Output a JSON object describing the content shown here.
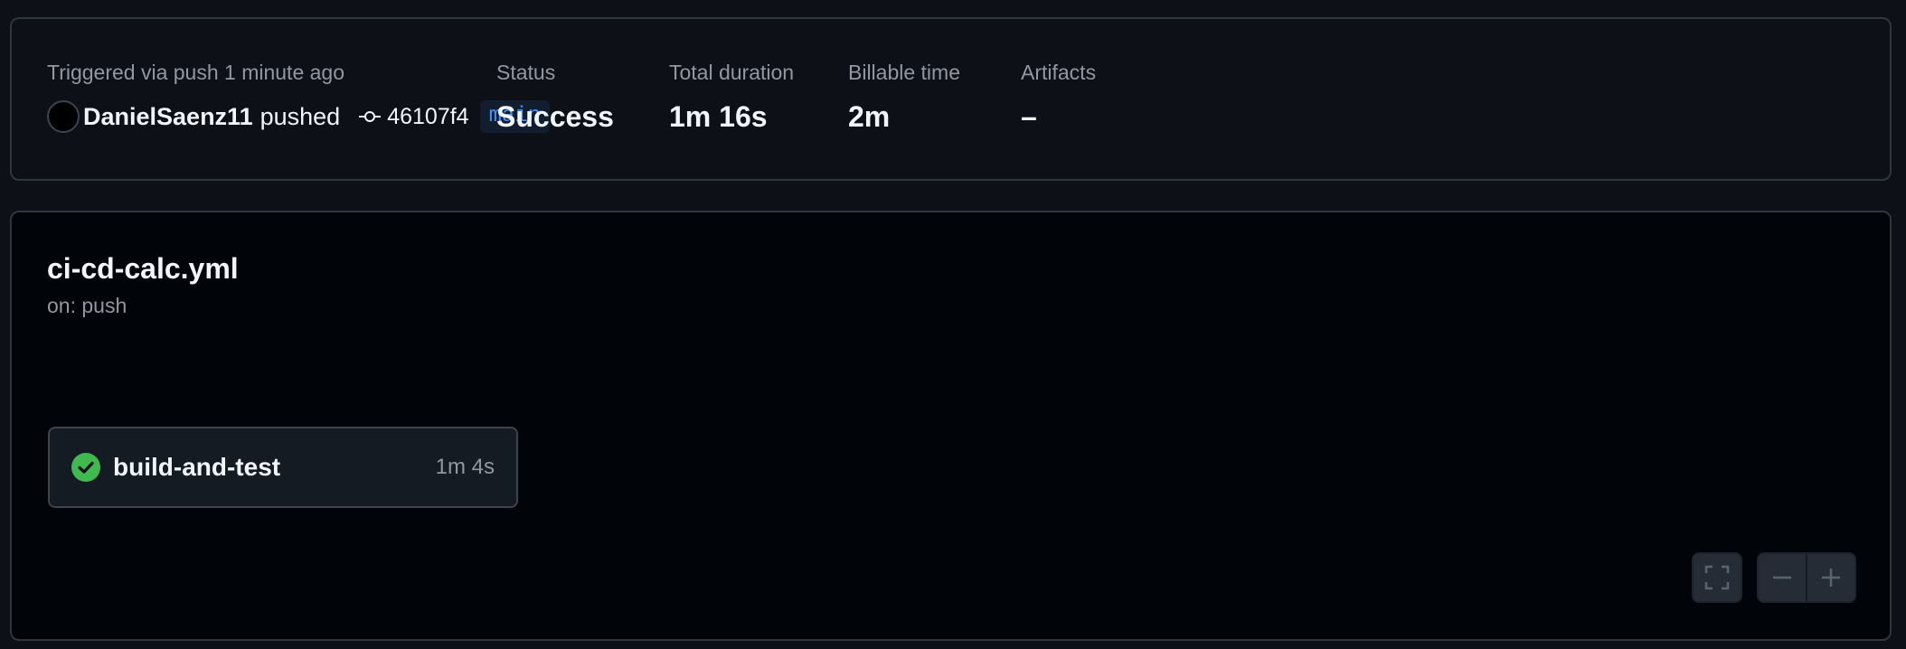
{
  "summary": {
    "triggered_label": "Triggered via push 1 minute ago",
    "actor": "DanielSaenz11",
    "pushed_text": "pushed",
    "commit_sha": "46107f4",
    "branch": "main",
    "status_label": "Status",
    "status_value": "Success",
    "duration_label": "Total duration",
    "duration_value": "1m 16s",
    "billable_label": "Billable time",
    "billable_value": "2m",
    "artifacts_label": "Artifacts",
    "artifacts_value": "–"
  },
  "workflow": {
    "file_name": "ci-cd-calc.yml",
    "trigger": "on: push",
    "jobs": [
      {
        "name": "build-and-test",
        "duration": "1m 4s",
        "status": "success",
        "status_icon": "check-circle-icon"
      }
    ]
  },
  "controls": {
    "fullscreen_icon": "fullscreen-icon",
    "zoom_out_icon": "minus-icon",
    "zoom_in_icon": "plus-icon"
  },
  "colors": {
    "background": "#0d1117",
    "graph_background": "#010409",
    "border": "#30363d",
    "success": "#3fb950",
    "branch_fg": "#4493f8",
    "branch_bg": "#121d2f",
    "muted_text": "#9198a1"
  }
}
